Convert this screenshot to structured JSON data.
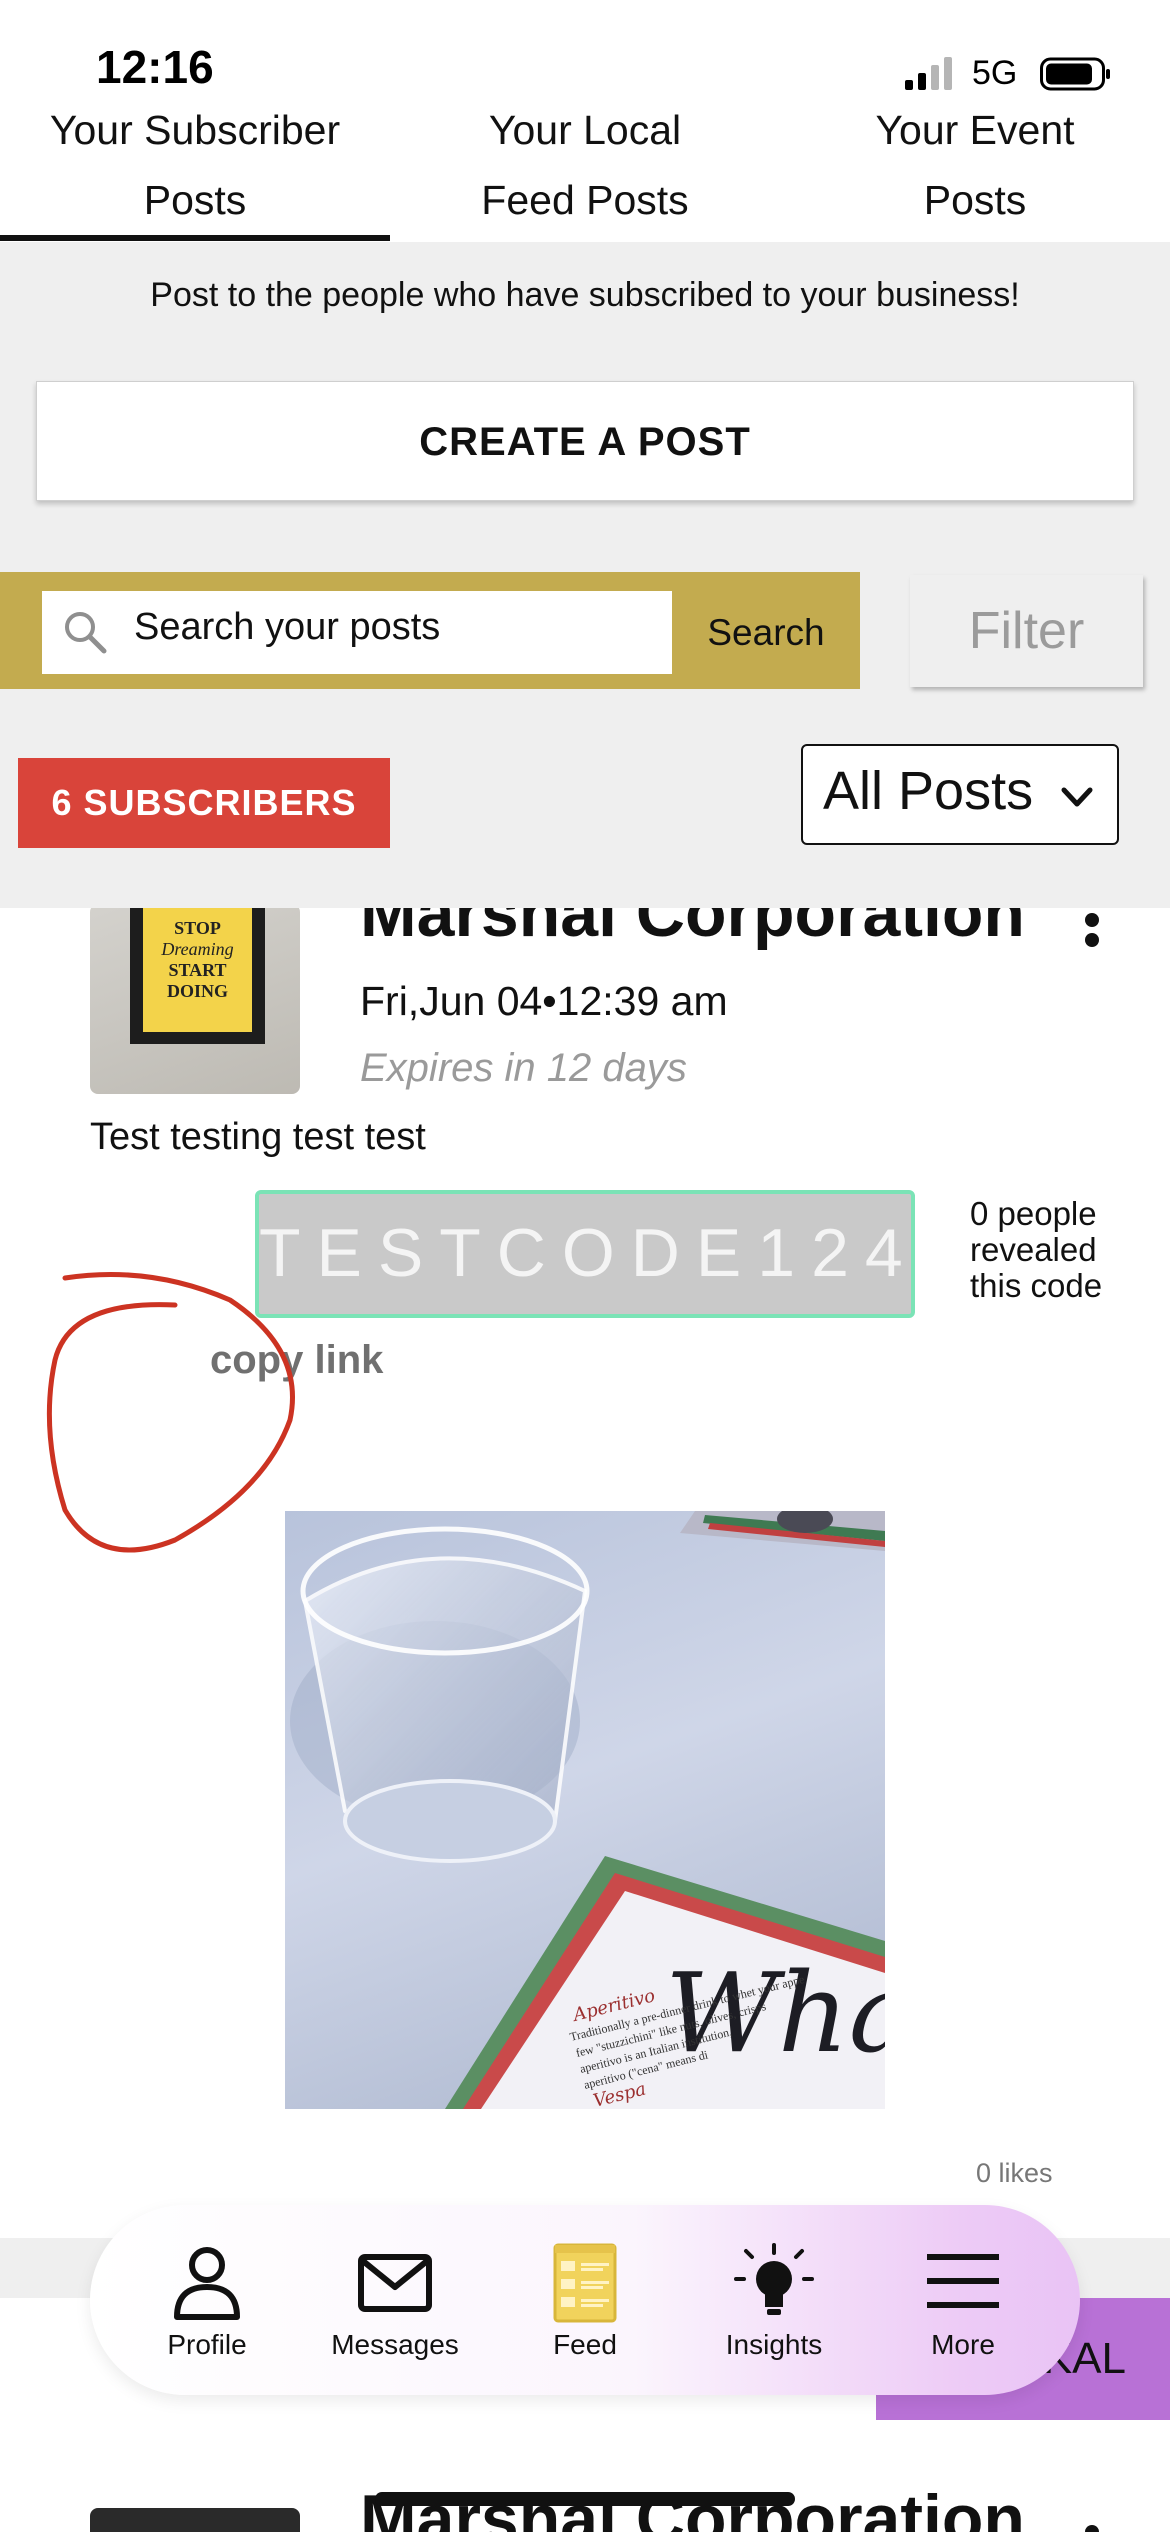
{
  "status_bar": {
    "time": "12:16",
    "network": "5G"
  },
  "tabs": [
    {
      "line1": "Your Subscriber",
      "line2": "Posts"
    },
    {
      "line1": "Your Local",
      "line2": "Feed Posts"
    },
    {
      "line1": "Your Event",
      "line2": "Posts"
    }
  ],
  "intro_text": "Post to the people who have subscribed to your business!",
  "create_button": "CREATE A POST",
  "search": {
    "placeholder": "Search your posts",
    "button": "Search"
  },
  "filter_button": "Filter",
  "subscribers_badge": "6 SUBSCRIBERS",
  "posts_select": {
    "selected": "All Posts"
  },
  "post": {
    "thumb_text": [
      "STOP",
      "Dreaming",
      "START",
      "DOING"
    ],
    "business_name": "Marshal Corporation",
    "date": "Fri,Jun 04•12:39 am",
    "expiry": "Expires in 12 days",
    "body": "Test testing test test",
    "promo_code": "TESTCODE124",
    "reveal_text": [
      "0 people",
      "revealed",
      "this code"
    ],
    "copy_link": "copy link",
    "likes": "0 likes",
    "photo_text": [
      "What",
      "Aperitivo",
      "Traditionally a pre-dinner drink to whet your appe",
      "few \"stuzzichini\" like nuts, olives, crisps",
      "aperitivo is an Italian institution,",
      "aperitivo (\"cena\" means di",
      "Vespa"
    ]
  },
  "second_post": {
    "business_name": "Marshal Corporation"
  },
  "purple_button_partial": "KAL",
  "bottom_nav": [
    {
      "label": "Profile",
      "icon": "person-icon"
    },
    {
      "label": "Messages",
      "icon": "mail-icon"
    },
    {
      "label": "Feed",
      "icon": "feed-icon"
    },
    {
      "label": "Insights",
      "icon": "lightbulb-icon"
    },
    {
      "label": "More",
      "icon": "menu-icon"
    }
  ],
  "colors": {
    "search_bar": "#c3ab4f",
    "subscribers_badge": "#d9443a",
    "code_border": "#7be3b6",
    "feed_icon": "#f1d35c",
    "annotation_circle": "#cc3322",
    "purple_button": "#b871d6"
  }
}
